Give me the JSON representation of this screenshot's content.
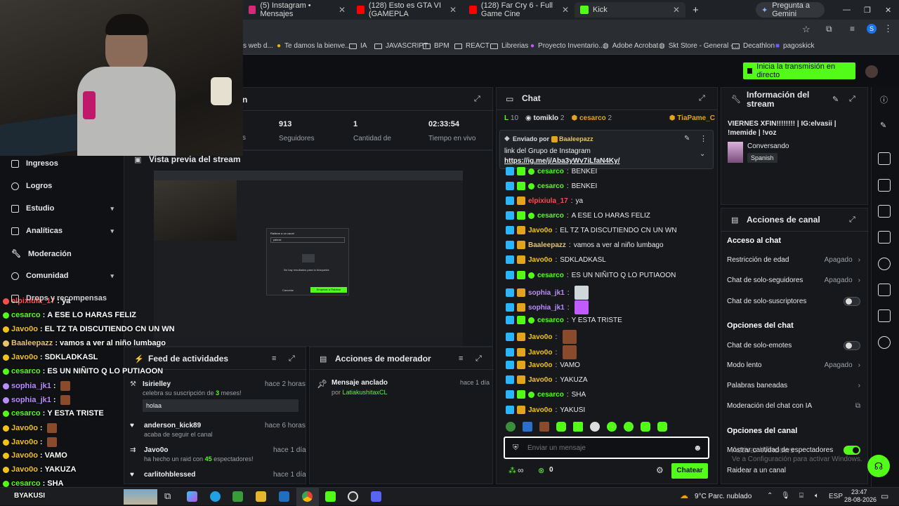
{
  "browser": {
    "tabs": [
      {
        "label": "(5) Instagram • Mensajes"
      },
      {
        "label": "(128) Esto es GTA VI (GAMEPLA"
      },
      {
        "label": "(128) Far Cry 6 - Full Game Cine"
      },
      {
        "label": "Kick"
      }
    ],
    "gemini_label": "Pregunta a Gemini",
    "profile_initial": "S",
    "bookmarks": [
      "s web d...",
      "Te damos la bienve...",
      "IA",
      "JAVASCRIPT",
      "BPM",
      "REACT",
      "Librerias",
      "Proyecto Inventario...",
      "Adobe Acrobat",
      "Skt Store - General -...",
      "Decathlon",
      "pagoskick"
    ]
  },
  "header": {
    "go_live_label": "Inicia la transmisión en directo"
  },
  "sidebar": {
    "items": [
      {
        "label": "Ingresos"
      },
      {
        "label": "Logros"
      },
      {
        "label": "Estudio"
      },
      {
        "label": "Analíticas"
      },
      {
        "label": "Moderación"
      },
      {
        "label": "Comunidad"
      },
      {
        "label": "Drops y recompensas"
      }
    ]
  },
  "stats": {
    "title_fragment": "n",
    "items": [
      {
        "value": "913",
        "label": "Seguidores"
      },
      {
        "value": "1",
        "label": "Cantidad de"
      },
      {
        "value": "02:33:54",
        "label": "Tiempo en vivo"
      }
    ],
    "hidden_label_fragment": "s"
  },
  "preview": {
    "title": "Vista previa del stream",
    "raid_dialog_title": "Raidear a un canal",
    "raid_search_value": "yakusi",
    "raid_empty": "No hay resultados para tu búsqueda",
    "raid_cancel": "Cancelar",
    "raid_start": "Empezar a Raidear"
  },
  "overlay_chat": [
    {
      "user": "elpixiula_17",
      "msg": "ya",
      "color": "#ff4d4d"
    },
    {
      "user": "cesarco",
      "msg": "A ESE LO HARAS FELIZ",
      "color": "#53fc18"
    },
    {
      "user": "Javo0o",
      "msg": "EL TZ TA DISCUTIENDO CN UN WN",
      "color": "#f3c21a"
    },
    {
      "user": "Baaleepazz",
      "msg": "vamos a ver al niño lumbago",
      "color": "#e6c36b"
    },
    {
      "user": "Javo0o",
      "msg": "SDKLADKASL",
      "color": "#f3c21a"
    },
    {
      "user": "cesarco",
      "msg": "ES UN NIÑITO Q LO PUTIAOON",
      "color": "#53fc18"
    },
    {
      "user": "sophia_jk1",
      "msg": "",
      "color": "#b98cff"
    },
    {
      "user": "sophia_jk1",
      "msg": "",
      "color": "#b98cff"
    },
    {
      "user": "cesarco",
      "msg": "Y ESTA TRISTE",
      "color": "#53fc18"
    },
    {
      "user": "Javo0o",
      "msg": "",
      "color": "#f3c21a"
    },
    {
      "user": "Javo0o",
      "msg": "",
      "color": "#f3c21a"
    },
    {
      "user": "Javo0o",
      "msg": "VAMO",
      "color": "#f3c21a"
    },
    {
      "user": "Javo0o",
      "msg": "YAKUZA",
      "color": "#f3c21a"
    },
    {
      "user": "cesarco",
      "msg": "SHA",
      "color": "#53fc18"
    },
    {
      "user": "Javo0o",
      "msg": "YAKUSI",
      "color": "#f3c21a"
    }
  ],
  "feed": {
    "title": "Feed de actividades",
    "items": [
      {
        "user": "Isirielley",
        "time": "hace 2 horas",
        "desc_pre": "celebra su suscripción de ",
        "highlight": "3",
        "desc_post": " meses!",
        "message": "holaa"
      },
      {
        "user": "anderson_kick89",
        "time": "hace 6 horas",
        "desc": "acaba de seguir el canal"
      },
      {
        "user": "Javo0o",
        "time": "hace 1 día",
        "desc_pre": "ha hecho un raid con ",
        "highlight": "45",
        "desc_post": " espectadores!"
      },
      {
        "user": "carlitohblessed",
        "time": "hace 1 día"
      }
    ]
  },
  "mod_actions": {
    "title": "Acciones de moderador",
    "items": [
      {
        "action": "Mensaje anclado",
        "by_prefix": "por ",
        "by": "LatiakushitaxCL",
        "time": "hace 1 día"
      }
    ]
  },
  "chat": {
    "title": "Chat",
    "top_users": [
      {
        "name": "L",
        "count": "10"
      },
      {
        "name": "tomiklo",
        "count": "2"
      },
      {
        "name": "cesarco",
        "count": "2"
      },
      {
        "name": "TiaPame_C",
        "count": ""
      }
    ],
    "pinned": {
      "sent_by_label": "Enviado por",
      "user": "Baaleepazz",
      "text": "link del Grupo de Instagram",
      "link": "https://ig.me/j/Aba3yWv7iLfaN4Ky/"
    },
    "messages": [
      {
        "user": "cesarco",
        "msg": "BENKEI",
        "color": "#53fc18"
      },
      {
        "user": "cesarco",
        "msg": "BENKEI",
        "color": "#53fc18"
      },
      {
        "user": "elpixiula_17",
        "msg": "ya",
        "color": "#ff4d4d"
      },
      {
        "user": "cesarco",
        "msg": "A ESE LO HARAS FELIZ",
        "color": "#53fc18"
      },
      {
        "user": "Javo0o",
        "msg": "EL TZ TA DISCUTIENDO CN UN WN",
        "color": "#f3c21a"
      },
      {
        "user": "Baaleepazz",
        "msg": "vamos a ver al niño lumbago",
        "color": "#e6c36b"
      },
      {
        "user": "Javo0o",
        "msg": "SDKLADKASL",
        "color": "#f3c21a"
      },
      {
        "user": "cesarco",
        "msg": "ES UN NIÑITO Q LO PUTIAOON",
        "color": "#53fc18"
      },
      {
        "user": "sophia_jk1",
        "msg": "",
        "color": "#b98cff"
      },
      {
        "user": "sophia_jk1",
        "msg": "",
        "color": "#b98cff"
      },
      {
        "user": "cesarco",
        "msg": "Y ESTA TRISTE",
        "color": "#53fc18"
      },
      {
        "user": "Javo0o",
        "msg": "",
        "color": "#f3c21a"
      },
      {
        "user": "Javo0o",
        "msg": "",
        "color": "#f3c21a"
      },
      {
        "user": "Javo0o",
        "msg": "VAMO",
        "color": "#f3c21a"
      },
      {
        "user": "Javo0o",
        "msg": "YAKUZA",
        "color": "#f3c21a"
      },
      {
        "user": "cesarco",
        "msg": "SHA",
        "color": "#53fc18"
      },
      {
        "user": "Javo0o",
        "msg": "YAKUSI",
        "color": "#f3c21a"
      }
    ],
    "input_placeholder": "Enviar un mensaje",
    "points_label": "∞",
    "kick_points": "0",
    "send_label": "Chatear"
  },
  "stream_info": {
    "title": "Información del stream",
    "stream_title": "VIERNES XFIN!!!!!!!! | IG:elvasii | !memide | !voz",
    "category": "Conversando",
    "language": "Spanish"
  },
  "channel_actions": {
    "title": "Acciones de canal",
    "sections": {
      "access": "Acceso al chat",
      "chat_options": "Opciones del chat",
      "channel_options": "Opciones del canal"
    },
    "age_restriction": {
      "label": "Restricción de edad",
      "value": "Apagado"
    },
    "followers_only": {
      "label": "Chat de solo-seguidores",
      "value": "Apagado"
    },
    "subs_only": {
      "label": "Chat de solo-suscriptores"
    },
    "emotes_only": {
      "label": "Chat de solo-emotes"
    },
    "slow_mode": {
      "label": "Modo lento",
      "value": "Apagado"
    },
    "banned_words": {
      "label": "Palabras baneadas"
    },
    "ai_mod": {
      "label": "Moderación del chat con IA"
    },
    "show_viewers": {
      "label": "Mostrar cantidad de espectadores"
    },
    "raid": {
      "label": "Raidear a un canal"
    }
  },
  "windows": {
    "activate_title": "Activar Windows",
    "activate_sub": "Ve a Configuración para activar Windows.",
    "weather": "9°C  Parc. nublado",
    "lang": "ESP",
    "time": "23:47",
    "date": "28-08-2026",
    "tray_user": "BYAKUSI"
  },
  "colors": {
    "accent": "#53fc18",
    "panel": "#16181c",
    "bg": "#0f1114"
  }
}
